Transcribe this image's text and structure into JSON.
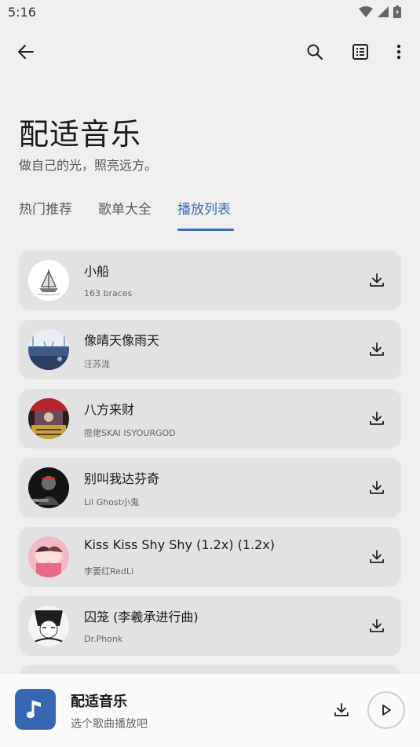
{
  "status": {
    "time": "5:16"
  },
  "toolbar": {
    "back_icon": "arrow-left-icon",
    "search_icon": "search-icon",
    "list_icon": "list-view-icon",
    "more_icon": "more-vert-icon"
  },
  "header": {
    "title": "配适音乐",
    "subtitle": "做自己的光，照亮远方。"
  },
  "tabs": [
    {
      "label": "热门推荐",
      "active": false
    },
    {
      "label": "歌单大全",
      "active": false
    },
    {
      "label": "播放列表",
      "active": true
    }
  ],
  "accent_color": "#3d6bb3",
  "songs": [
    {
      "title": "小船",
      "artist": "163 braces"
    },
    {
      "title": "像晴天像雨天",
      "artist": "汪苏泷"
    },
    {
      "title": "八方来财",
      "artist": "揽佬SKAI ISYOURGOD"
    },
    {
      "title": "别叫我达芬奇",
      "artist": "Lil Ghost小鬼"
    },
    {
      "title": "Kiss Kiss Shy Shy (1.2x) (1.2x)",
      "artist": "李要红RedLi"
    },
    {
      "title": "囚笼 (李羲承进行曲)",
      "artist": "Dr.Phonk"
    }
  ],
  "player": {
    "title": "配适音乐",
    "subtitle": "选个歌曲播放吧",
    "art_color": "#3567b2"
  }
}
